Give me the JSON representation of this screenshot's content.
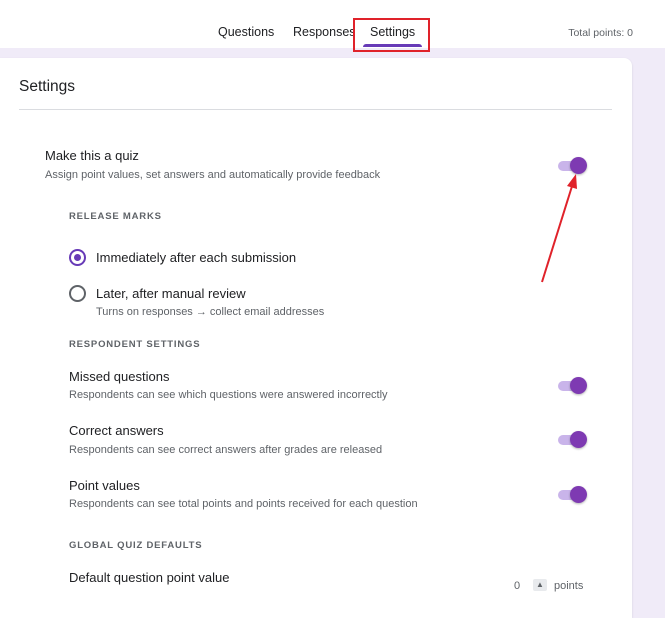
{
  "tabs": {
    "questions": "Questions",
    "responses": "Responses",
    "settings": "Settings"
  },
  "header": {
    "total_points": "Total points: 0"
  },
  "settings": {
    "title": "Settings",
    "quiz": {
      "title": "Make this a quiz",
      "subtitle": "Assign point values, set answers and automatically provide feedback",
      "enabled": true
    },
    "release_marks": {
      "heading": "RELEASE MARKS",
      "options": [
        {
          "label": "Immediately after each submission",
          "selected": true
        },
        {
          "label": "Later, after manual review",
          "selected": false,
          "sub": "Turns on responses → collect email addresses"
        }
      ]
    },
    "respondent": {
      "heading": "RESPONDENT SETTINGS",
      "items": [
        {
          "title": "Missed questions",
          "subtitle": "Respondents can see which questions were answered incorrectly",
          "enabled": true
        },
        {
          "title": "Correct answers",
          "subtitle": "Respondents can see correct answers after grades are released",
          "enabled": true
        },
        {
          "title": "Point values",
          "subtitle": "Respondents can see total points and points received for each question",
          "enabled": true
        }
      ]
    },
    "defaults": {
      "heading": "GLOBAL QUIZ DEFAULTS",
      "point_value_title": "Default question point value",
      "point_value": "0",
      "points_label": "points"
    }
  },
  "colors": {
    "accent": "#673ab7",
    "highlight": "#e0222a",
    "background": "#f0ebf8"
  }
}
